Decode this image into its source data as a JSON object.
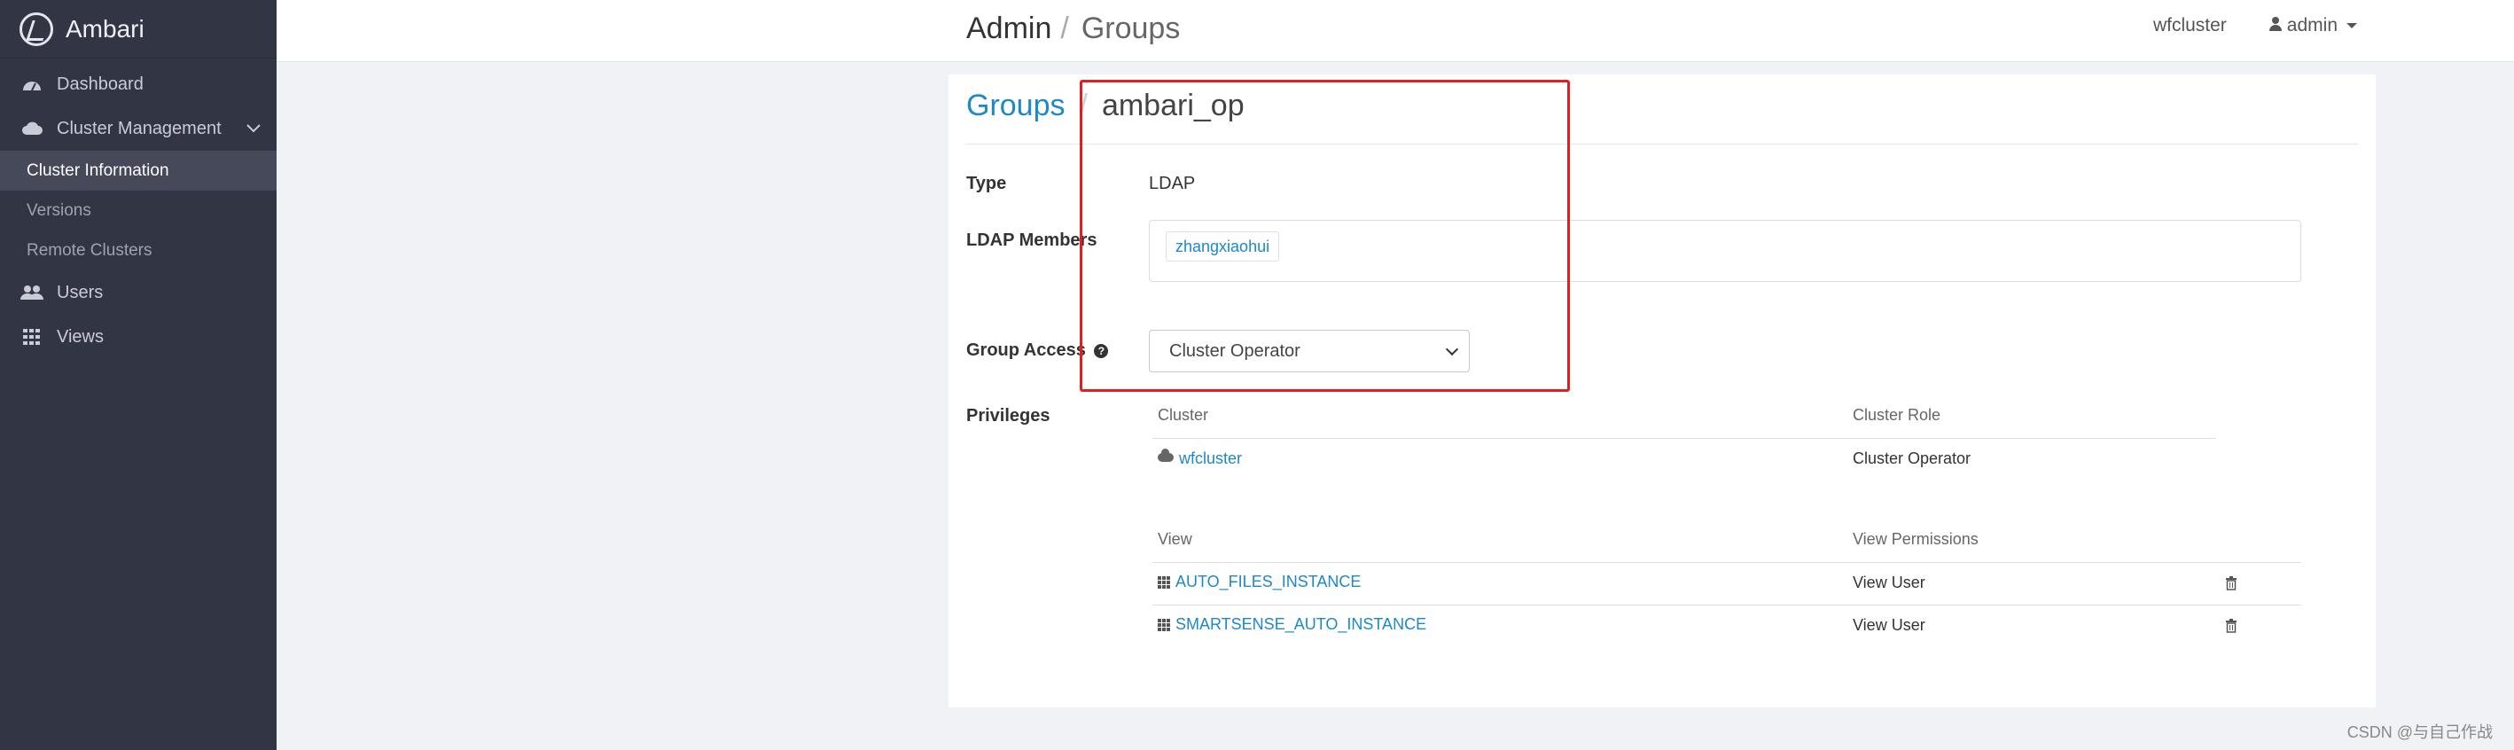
{
  "brand": {
    "name": "Ambari"
  },
  "sidebar": {
    "items": [
      {
        "label": "Dashboard",
        "icon": "dashboard-icon"
      },
      {
        "label": "Cluster Management",
        "icon": "cloud-icon"
      },
      {
        "label": "Users",
        "icon": "users-icon"
      },
      {
        "label": "Views",
        "icon": "grid-icon"
      }
    ],
    "subitems": [
      {
        "label": "Cluster Information",
        "active": true
      },
      {
        "label": "Versions",
        "active": false
      },
      {
        "label": "Remote Clusters",
        "active": false
      }
    ]
  },
  "header": {
    "breadcrumb_root": "Admin",
    "breadcrumb_sep": "/",
    "breadcrumb_current": "Groups",
    "cluster_name": "wfcluster",
    "user_name": "admin"
  },
  "group": {
    "breadcrumb_link": "Groups",
    "breadcrumb_sep": "/",
    "name": "ambari_op",
    "type_label": "Type",
    "type_value": "LDAP",
    "members_label": "LDAP Members",
    "members": [
      "zhangxiaohui"
    ],
    "access_label": "Group Access",
    "access_value": "Cluster Operator",
    "privileges_label": "Privileges"
  },
  "privileges": {
    "cluster_header": "Cluster",
    "cluster_role_header": "Cluster Role",
    "cluster_rows": [
      {
        "name": "wfcluster",
        "role": "Cluster Operator"
      }
    ],
    "view_header": "View",
    "view_perm_header": "View Permissions",
    "view_rows": [
      {
        "name": "AUTO_FILES_INSTANCE",
        "permission": "View User"
      },
      {
        "name": "SMARTSENSE_AUTO_INSTANCE",
        "permission": "View User"
      }
    ]
  },
  "colors": {
    "accent": "#1e88c8",
    "sidebar_bg": "#323544",
    "highlight": "#e02020"
  },
  "watermark": "CSDN @与自己作战"
}
